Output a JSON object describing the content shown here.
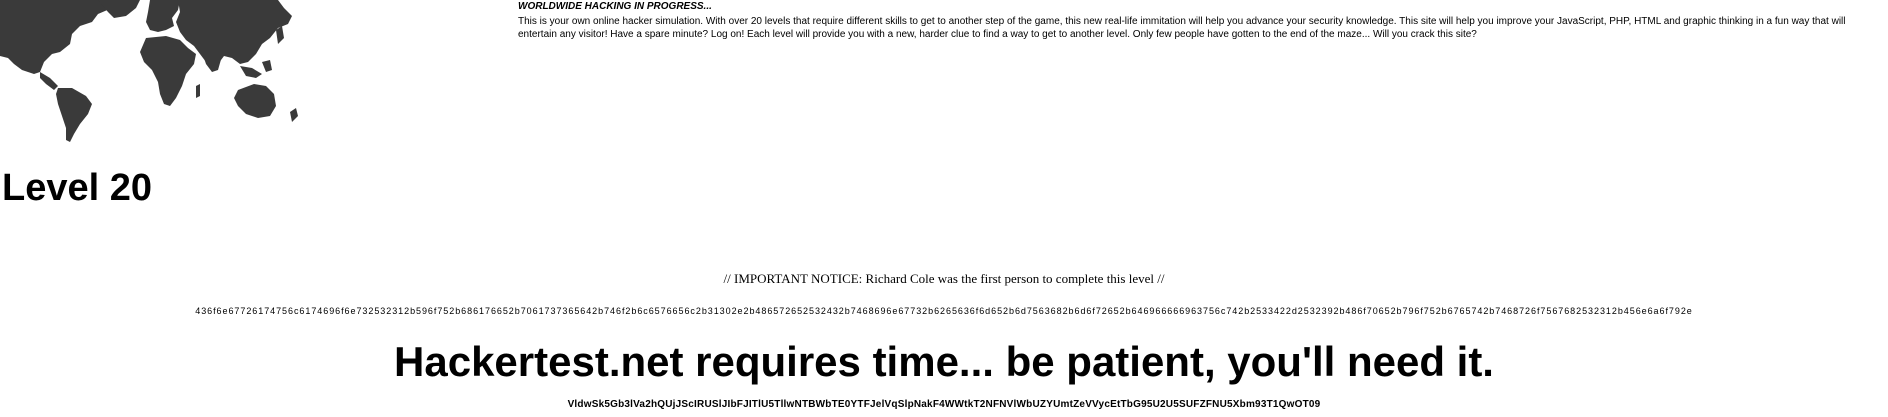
{
  "header": {
    "title": "WORLDWIDE HACKING IN PROGRESS...",
    "description": "This is your own online hacker simulation. With over 20 levels that require different skills to get to another step of the game, this new real-life immitation will help you advance your security knowledge. This site will help you improve your JavaScript, PHP, HTML and graphic thinking in a fun way that will entertain any visitor! Have a spare minute? Log on! Each level will provide you with a new, harder clue to find a way to get to another level. Only few people have gotten to the end of the maze... Will you crack this site?"
  },
  "level": {
    "title": "Level 20"
  },
  "notice": {
    "text": "// IMPORTANT NOTICE: Richard Cole was the first person to complete this level //"
  },
  "clues": {
    "hex": "436f6e67726174756c6174696f6e732532312b596f752b686176652b7061737365642b746f2b6c6576656c2b31302e2b486572652532432b7468696e67732b6265636f6d652b6d7563682b6d6f72652b646966666963756c742b2533422d2532392b486f70652b796f752b6765742b7468726f7567682532312b456e6a6f792e",
    "base64": "VldwSk5Gb3lVa2hQUjJScIRUSlJIbFJITlU5TllwNTBWbTE0YTFJelVqSlpNakF4WWtkT2NFNVlWbUZYUmtZeVVycEtTbG95U2U5SUFZFNU5Xbm93T1QwOT09"
  },
  "footer": {
    "patience_text": "Hackertest.net requires time... be patient, you'll need it."
  },
  "colors": {
    "map": "#3a3a3a",
    "text": "#000000",
    "background": "#ffffff"
  },
  "icons": {
    "map": "world-map-image"
  }
}
